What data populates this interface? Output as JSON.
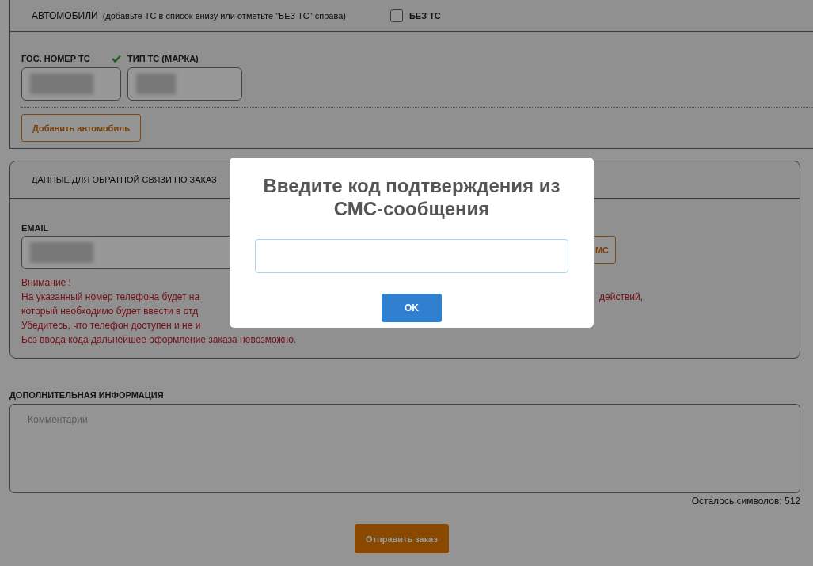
{
  "vehicles": {
    "title": "АВТОМОБИЛИ",
    "hint": "(добавьте ТС в список внизу или отметьте \"БЕЗ ТС\" справа)",
    "no_vehicle": {
      "label": "БЕЗ ТС",
      "checked": false
    },
    "fields": [
      {
        "label": "ГОС. НОМЕР ТС",
        "valid": true
      },
      {
        "label": "ТИП ТС (МАРКА)",
        "valid": false
      }
    ],
    "add_button": "Добавить автомобиль"
  },
  "contact": {
    "title": "ДАННЫЕ ДЛЯ ОБРАТНОЙ СВЯЗИ ПО ЗАКАЗ",
    "email_label": "EMAIL",
    "sms_button": "МС",
    "warning_lines": [
      {
        "left": "Внимание !"
      },
      {
        "left": "На указанный номер телефона будет на",
        "right": "действий,"
      },
      {
        "left": "который необходимо будет ввести в отд"
      },
      {
        "left": "Убедитесь, что телефон доступен и не и"
      },
      {
        "left": "Без ввода кода дальнейшее оформление заказа невозможно."
      }
    ]
  },
  "additional": {
    "label": "ДОПОЛНИТЕЛЬНАЯ ИНФОРМАЦИЯ",
    "placeholder": "Комментарии",
    "remaining": "Осталось символов: 512"
  },
  "submit_button": "Отправить заказ",
  "modal": {
    "title": "Введите код подтверждения из СМС-сообщения",
    "ok_button": "OK"
  }
}
